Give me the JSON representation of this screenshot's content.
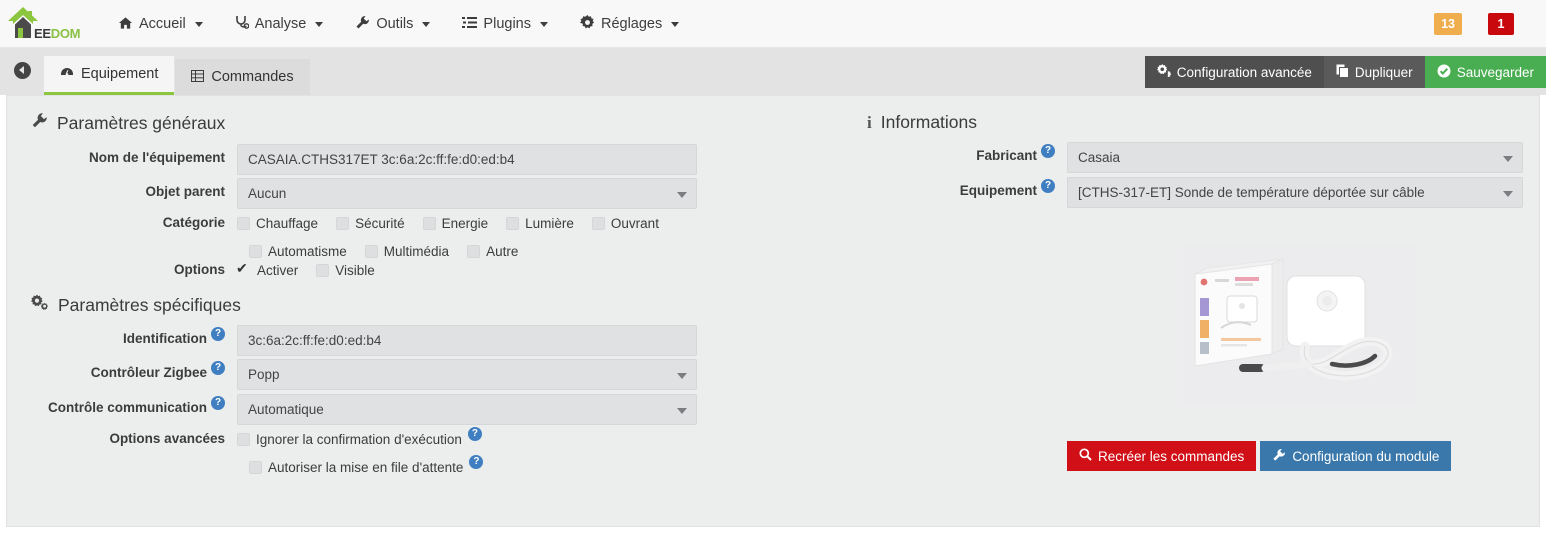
{
  "navbar": {
    "logo": {
      "part1": "EE",
      "part2": "DOM",
      "icon": "house-logo"
    },
    "items": [
      {
        "label": "Accueil",
        "icon": "home-icon",
        "glyph": "⌂"
      },
      {
        "label": "Analyse",
        "icon": "stethoscope-icon",
        "glyph": "⚕"
      },
      {
        "label": "Outils",
        "icon": "wrench-icon",
        "glyph": "🔧"
      },
      {
        "label": "Plugins",
        "icon": "list-icon",
        "glyph": "☰"
      },
      {
        "label": "Réglages",
        "icon": "gear-icon",
        "glyph": "⚙"
      }
    ],
    "badges": [
      {
        "value": "13",
        "color": "#f0ad4e",
        "name": "warning-badge"
      },
      {
        "value": "1",
        "color": "#c9080e",
        "name": "error-badge"
      }
    ]
  },
  "tabbar": {
    "back_label": "",
    "tabs": [
      {
        "label": "Equipement",
        "icon": "dashboard-icon",
        "glyph": "◔",
        "active": true
      },
      {
        "label": "Commandes",
        "icon": "table-icon",
        "glyph": "▤",
        "active": false
      }
    ],
    "actions": [
      {
        "label": "Configuration avancée",
        "icon": "gears-icon",
        "glyph": "⚙",
        "color": "#4f4f4f"
      },
      {
        "label": "Dupliquer",
        "icon": "copy-icon",
        "glyph": "❐",
        "color": "#5a5a5a"
      },
      {
        "label": "Sauvegarder",
        "icon": "check-circle-icon",
        "glyph": "✔",
        "color": "#49ad52"
      }
    ]
  },
  "general": {
    "title": "Paramètres généraux",
    "icon": "wrench-icon",
    "name_label": "Nom de l'équipement",
    "name_value": "CASAIA.CTHS317ET 3c:6a:2c:ff:fe:d0:ed:b4",
    "parent_label": "Objet parent",
    "parent_value": "Aucun",
    "category_label": "Catégorie",
    "categories_row1": [
      {
        "label": "Chauffage",
        "checked": false
      },
      {
        "label": "Sécurité",
        "checked": false
      },
      {
        "label": "Energie",
        "checked": false
      },
      {
        "label": "Lumière",
        "checked": false
      },
      {
        "label": "Ouvrant",
        "checked": false
      }
    ],
    "categories_row2": [
      {
        "label": "Automatisme",
        "checked": false
      },
      {
        "label": "Multimédia",
        "checked": false
      },
      {
        "label": "Autre",
        "checked": false
      }
    ],
    "options_label": "Options",
    "options": [
      {
        "label": "Activer",
        "checked": true
      },
      {
        "label": "Visible",
        "checked": false
      }
    ]
  },
  "specific": {
    "title": "Paramètres spécifiques",
    "icon": "gears-icon",
    "identification_label": "Identification",
    "identification_value": "3c:6a:2c:ff:fe:d0:ed:b4",
    "controller_label": "Contrôleur Zigbee",
    "controller_value": "Popp",
    "communication_label": "Contrôle communication",
    "communication_value": "Automatique",
    "advanced_label": "Options avancées",
    "advanced": [
      {
        "label": "Ignorer la confirmation d'exécution",
        "checked": false
      },
      {
        "label": "Autoriser la mise en file d'attente",
        "checked": false
      }
    ]
  },
  "informations": {
    "title": "Informations",
    "icon": "info-icon",
    "manufacturer_label": "Fabricant",
    "manufacturer_value": "Casaia",
    "equipment_label": "Equipement",
    "equipment_value": "[CTHS-317-ET] Sonde de température déportée sur câble",
    "product_image_alt": "zigbee-temperature-probe-product-photo",
    "buttons": [
      {
        "label": "Recréer les commandes",
        "icon": "search-icon",
        "glyph": "🔍",
        "color": "#d00f17"
      },
      {
        "label": "Configuration du module",
        "icon": "wrench-icon",
        "glyph": "🔧",
        "color": "#3a78ab"
      }
    ]
  },
  "theme": {
    "accent_green": "#8cc63f",
    "save_green": "#49ad52",
    "help_blue": "#3f7fc1",
    "danger_red": "#d00f17",
    "info_blue": "#3a78ab",
    "panel_bg": "#eceded",
    "navbar_bg": "#f8f8f8",
    "tabstrip_bg": "#e3e3e3"
  }
}
